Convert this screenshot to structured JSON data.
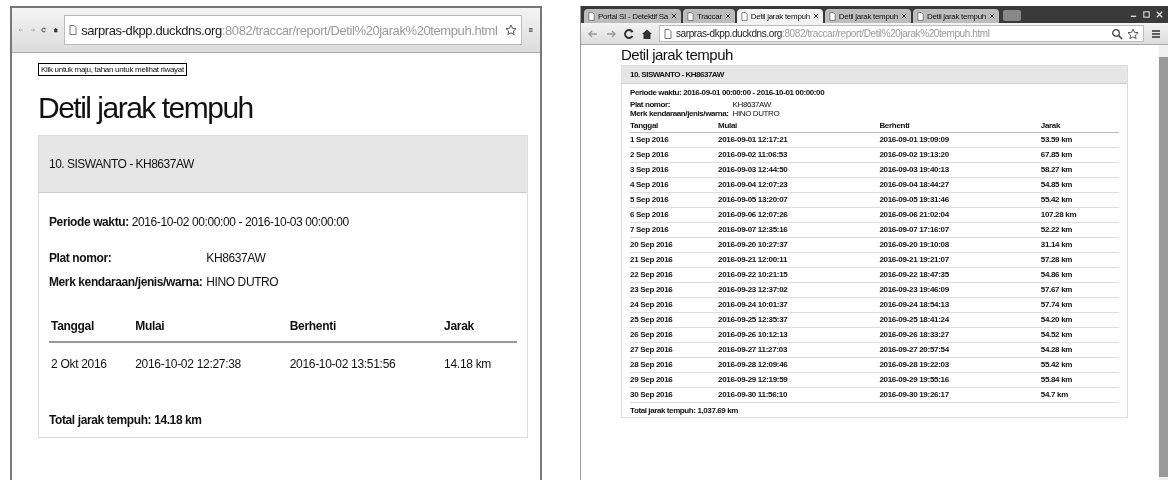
{
  "windows": [
    {
      "address": {
        "host": "sarpras-dkpp.duckdns.org",
        "path": ":8082/traccar/report/Detil%20jarak%20tempuh.html"
      },
      "tooltip": "Klik untuk maju, tahan untuk melihat riwayat",
      "page": {
        "title": "Detil jarak tempuh",
        "vehicle": "10. SISWANTO - KH8637AW",
        "period_label": "Periode waktu:",
        "period_value": "2016-10-02 00:00:00 - 2016-10-03 00:00:00",
        "fields": [
          {
            "label": "Plat nomor:",
            "value": "KH8637AW"
          },
          {
            "label": "Merk kendaraan/jenis/warna:",
            "value": "HINO DUTRO"
          }
        ],
        "columns": [
          "Tanggal",
          "Mulai",
          "Berhenti",
          "Jarak"
        ],
        "rows": [
          [
            "2 Okt 2016",
            "2016-10-02 12:27:38",
            "2016-10-02 13:51:56",
            "14.18 km"
          ]
        ],
        "total": "Total jarak tempuh: 14.18 km"
      }
    },
    {
      "tabs": [
        {
          "title": "Portal SI - Detektif Sa",
          "selected": false
        },
        {
          "title": "Traccar",
          "selected": false
        },
        {
          "title": "Detil jarak tempuh",
          "selected": true
        },
        {
          "title": "Detil jarak tempuh",
          "selected": false
        },
        {
          "title": "Detil jarak tempuh",
          "selected": false
        }
      ],
      "address": {
        "host": "sarpras-dkpp.duckdns.org",
        "path": ":8082/traccar/report/Detil%20jarak%20tempuh.html"
      },
      "page": {
        "title": "Detil jarak tempuh",
        "vehicle": "10. SISWANTO - KH8637AW",
        "period_label": "Periode waktu:",
        "period_value": "2016-09-01 00:00:00 - 2016-10-01 00:00:00",
        "fields": [
          {
            "label": "Plat nomor:",
            "value": "KH8637AW"
          },
          {
            "label": "Merk kendaraan/jenis/warna:",
            "value": "HINO DUTRO"
          }
        ],
        "columns": [
          "Tanggal",
          "Mulai",
          "Berhenti",
          "Jarak"
        ],
        "rows": [
          [
            "1 Sep 2016",
            "2016-09-01 12:17:21",
            "2016-09-01 19:09:09",
            "53.59 km"
          ],
          [
            "2 Sep 2016",
            "2016-09-02 11:06:53",
            "2016-09-02 19:13:20",
            "67.85 km"
          ],
          [
            "3 Sep 2016",
            "2016-09-03 12:44:50",
            "2016-09-03 19:40:13",
            "58.27 km"
          ],
          [
            "4 Sep 2016",
            "2016-09-04 12:07:23",
            "2016-09-04 18:44:27",
            "54.85 km"
          ],
          [
            "5 Sep 2016",
            "2016-09-05 13:20:07",
            "2016-09-05 19:31:46",
            "55.42 km"
          ],
          [
            "6 Sep 2016",
            "2016-09-06 12:07:26",
            "2016-09-06 21:02:04",
            "107.28 km"
          ],
          [
            "7 Sep 2016",
            "2016-09-07 12:35:16",
            "2016-09-07 17:16:07",
            "52.22 km"
          ],
          [
            "20 Sep 2016",
            "2016-09-20 10:27:37",
            "2016-09-20 19:10:08",
            "31.14 km"
          ],
          [
            "21 Sep 2016",
            "2016-09-21 12:00:11",
            "2016-09-21 19:21:07",
            "57.28 km"
          ],
          [
            "22 Sep 2016",
            "2016-09-22 10:21:15",
            "2016-09-22 18:47:35",
            "54.86 km"
          ],
          [
            "23 Sep 2016",
            "2016-09-23 12:37:02",
            "2016-09-23 19:46:09",
            "57.67 km"
          ],
          [
            "24 Sep 2016",
            "2016-09-24 10:01:37",
            "2016-09-24 18:54:13",
            "57.74 km"
          ],
          [
            "25 Sep 2016",
            "2016-09-25 12:35:37",
            "2016-09-25 18:41:24",
            "54.20 km"
          ],
          [
            "26 Sep 2016",
            "2016-09-26 10:12:13",
            "2016-09-26 18:33:27",
            "54.52 km"
          ],
          [
            "27 Sep 2016",
            "2016-09-27 11:27:03",
            "2016-09-27 20:57:54",
            "54.28 km"
          ],
          [
            "28 Sep 2016",
            "2016-09-28 12:09:46",
            "2016-09-28 19:22:03",
            "55.42 km"
          ],
          [
            "29 Sep 2016",
            "2016-09-29 12:19:59",
            "2016-09-29 19:55:16",
            "55.84 km"
          ],
          [
            "30 Sep 2016",
            "2016-09-30 11:56:10",
            "2016-09-30 19:26:17",
            "54.7 km"
          ]
        ],
        "total": "Total jarak tempuh: 1,037.69 km"
      }
    }
  ]
}
